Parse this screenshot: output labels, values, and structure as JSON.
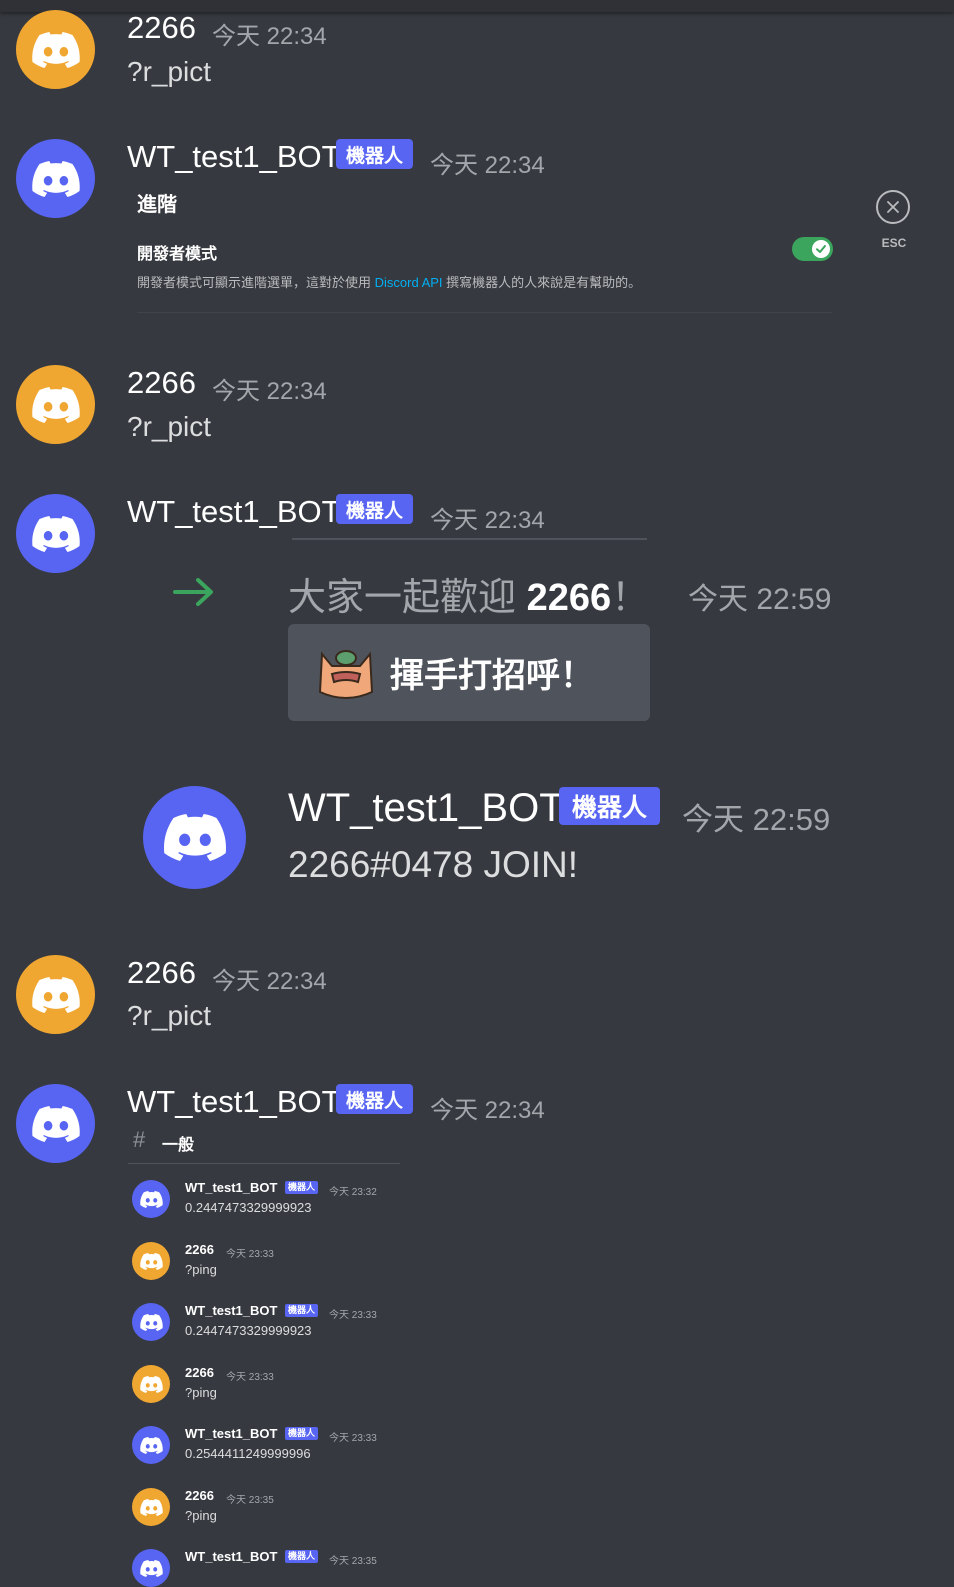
{
  "labels": {
    "bot_tag": "機器人",
    "reply_cmd": "?r_pict",
    "esc": "ESC"
  },
  "messages": [
    {
      "user": "2266",
      "time": "今天 22:34",
      "text": "?r_pict"
    },
    {
      "user": "WT_test1_BOT",
      "time": "今天 22:34"
    },
    {
      "user": "2266",
      "time": "今天 22:34",
      "text": "?r_pict"
    },
    {
      "user": "WT_test1_BOT",
      "time": "今天 22:34"
    },
    {
      "user": "2266",
      "time": "今天 22:34",
      "text": "?r_pict"
    },
    {
      "user": "WT_test1_BOT",
      "time": "今天 22:34"
    }
  ],
  "settings_embed": {
    "title": "進階",
    "dev_mode_label": "開發者模式",
    "desc_before": "開發者模式可顯示進階選單，這對於使用 ",
    "desc_link": "Discord API",
    "desc_after": " 撰寫機器人的人來說是有幫助的。",
    "dev_mode_enabled": true
  },
  "join_embed": {
    "welcome_prefix": "大家一起歡迎 ",
    "welcome_user": "2266",
    "welcome_suffix": "！",
    "welcome_time": "今天 22:59",
    "wave_button": "揮手打招呼！",
    "bot_name": "WT_test1_BOT",
    "bot_time": "今天 22:59",
    "bot_text": "2266#0478 JOIN!"
  },
  "channel_embed": {
    "channel": "一般",
    "rows": [
      {
        "user": "WT_test1_BOT",
        "bot": true,
        "time": "今天 23:32",
        "text": "0.2447473329999923"
      },
      {
        "user": "2266",
        "bot": false,
        "time": "今天 23:33",
        "text": "?ping"
      },
      {
        "user": "WT_test1_BOT",
        "bot": true,
        "time": "今天 23:33",
        "text": "0.2447473329999923"
      },
      {
        "user": "2266",
        "bot": false,
        "time": "今天 23:33",
        "text": "?ping"
      },
      {
        "user": "WT_test1_BOT",
        "bot": true,
        "time": "今天 23:33",
        "text": "0.2544411249999996"
      },
      {
        "user": "2266",
        "bot": false,
        "time": "今天 23:35",
        "text": "?ping"
      },
      {
        "user": "WT_test1_BOT",
        "bot": true,
        "time": "今天 23:35",
        "text": ""
      }
    ]
  },
  "colors": {
    "background": "#36393f",
    "blurple": "#5865f2",
    "user_avatar": "#f0a732",
    "toggle_on": "#3ba55d",
    "link": "#00aff4"
  }
}
